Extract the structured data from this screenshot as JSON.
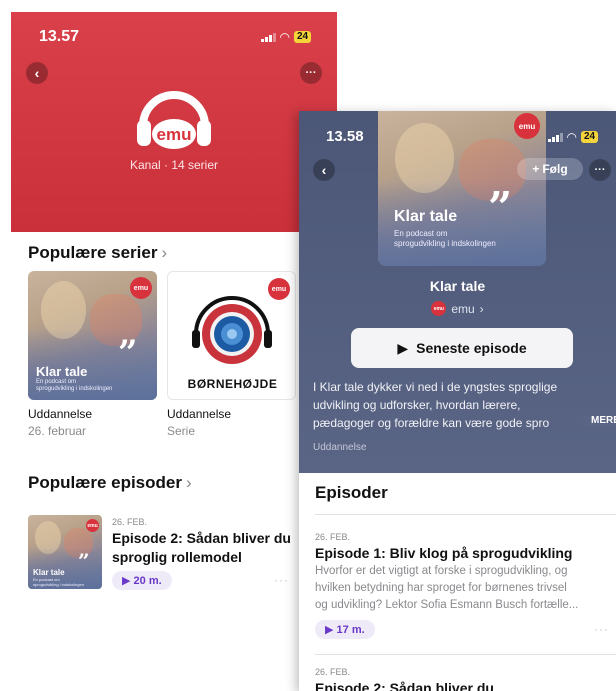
{
  "left": {
    "status": {
      "time": "13.57",
      "battery": "24"
    },
    "header": {
      "logo_text": "emu",
      "subtitle": "Kanal · 14 serier"
    },
    "popular_series": {
      "title": "Populære serier",
      "items": [
        {
          "art_title": "Klar tale",
          "art_subtitle_1": "En podcast om",
          "art_subtitle_2": "sprogudvikling i indskolingen",
          "category": "Uddannelse",
          "sub": "26. februar"
        },
        {
          "art_title": "BØRNEHØJDE",
          "category": "Uddannelse",
          "sub": "Serie"
        }
      ]
    },
    "popular_episodes": {
      "title": "Populære episoder",
      "items": [
        {
          "date": "26. FEB.",
          "title_1": "Episode 2: Sådan bliver du",
          "title_2": "sproglig rollemodel",
          "duration": "20 m.",
          "art_title": "Klar tale",
          "art_subtitle_1": "En podcast om",
          "art_subtitle_2": "sprogudvikling i indskolingen"
        }
      ]
    }
  },
  "right": {
    "status": {
      "time": "13.58",
      "battery": "24"
    },
    "follow_label": "Følg",
    "art": {
      "title": "Klar tale",
      "subtitle_1": "En podcast om",
      "subtitle_2": "sprogudvikling i indskolingen"
    },
    "podcast_title": "Klar tale",
    "channel_name": "emu",
    "play_label": "Seneste episode",
    "description_1": "I Klar tale dykker vi ned i de yngstes sproglige",
    "description_2": "udvikling og udforsker, hvordan lærere,",
    "description_3": "pædagoger og forældre kan være gode spro",
    "more_label": "MERE",
    "category": "Uddannelse",
    "episodes_title": "Episoder",
    "episodes": [
      {
        "date": "26. FEB.",
        "title": "Episode 1: Bliv klog på sprogudvikling",
        "desc_1": "Hvorfor er det vigtigt at forske i sprogudvikling, og",
        "desc_2": "hvilken betydning har sproget for børnenes trivsel",
        "desc_3": "og udvikling? Lektor Sofia Esmann Busch fortælle...",
        "duration": "17 m."
      },
      {
        "date": "26. FEB.",
        "title": "Episode 2: Sådan bliver du"
      }
    ]
  },
  "colors": {
    "emu_red": "#d8333d",
    "hero_blue": "#55607f",
    "accent_purple": "#6a38c8"
  }
}
